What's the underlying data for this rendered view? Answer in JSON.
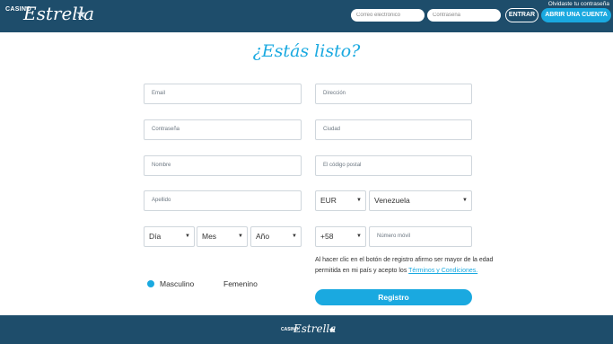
{
  "header": {
    "logo_casino": "CASINO",
    "logo_estrella": "Estrella",
    "forgot_password": "Olvidaste tu contraseña",
    "email_placeholder": "Correo electrónico",
    "password_placeholder": "Contraseña",
    "login_label": "ENTRAR",
    "signup_label": "ABRIR UNA CUENTA"
  },
  "title": "¿Estás listo?",
  "form": {
    "email": "Email",
    "password": "Contraseña",
    "name": "Nombre",
    "surname": "Apellido",
    "address": "Dirección",
    "city": "Ciudad",
    "postal": "El código postal",
    "day": "Día",
    "month": "Mes",
    "year": "Año",
    "currency": "EUR",
    "country": "Venezuela",
    "phone_code": "+58",
    "phone_placeholder": "Número móvil",
    "gender_male": "Masculino",
    "gender_female": "Femenino",
    "terms_text": "Al hacer clic en el botón de registro afirmo ser mayor de la edad permitida en mi país y acepto los",
    "terms_link": "Términos y Condiciones.",
    "register_label": "Registro"
  },
  "footer": {
    "logo_casino": "CASINO",
    "logo_estrella": "Estrella"
  },
  "colors": {
    "navy": "#1e4d6b",
    "accent": "#1aa9e0"
  }
}
